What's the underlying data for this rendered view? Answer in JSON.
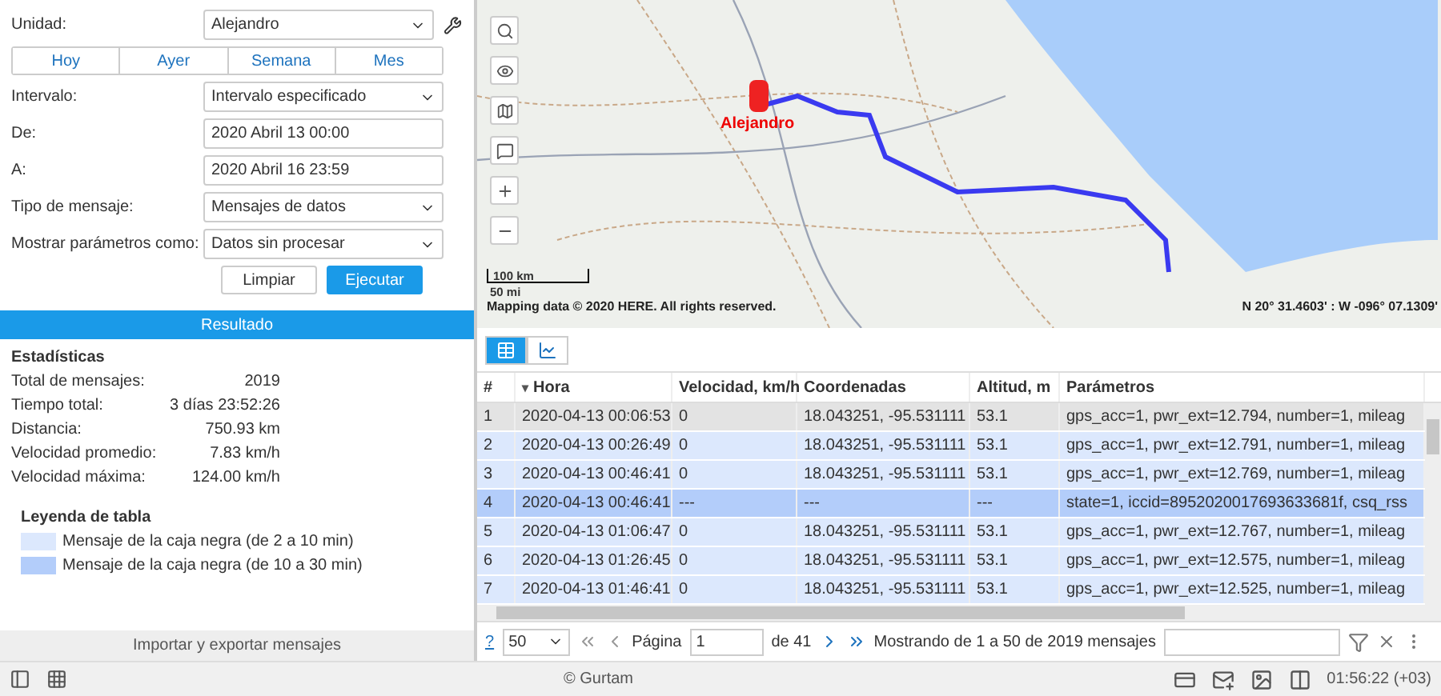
{
  "form": {
    "unit": {
      "label": "Unidad:",
      "value": "Alejandro"
    },
    "quick": [
      {
        "label": "Hoy",
        "selected": false
      },
      {
        "label": "Ayer",
        "selected": false
      },
      {
        "label": "Semana",
        "selected": false
      },
      {
        "label": "Mes",
        "selected": false
      }
    ],
    "fields": [
      {
        "kind": "select",
        "label": "Intervalo:",
        "value": "Intervalo especificado"
      },
      {
        "kind": "input",
        "label": "De:",
        "value": "2020 Abril 13 00:00"
      },
      {
        "kind": "input",
        "label": "A:",
        "value": "2020 Abril 16 23:59"
      },
      {
        "kind": "select",
        "label": "Tipo de mensaje:",
        "value": "Mensajes de datos"
      },
      {
        "kind": "select",
        "label": "Mostrar parámetros como:",
        "value": "Datos sin procesar"
      }
    ],
    "buttons": [
      "Limpiar",
      "Ejecutar"
    ]
  },
  "result": {
    "title": "Resultado",
    "stats_title": "Estadísticas",
    "stats": [
      {
        "label": "Total de mensajes:",
        "value": "2019"
      },
      {
        "label": "Tiempo total:",
        "value": "3 días 23:52:26"
      },
      {
        "label": "Distancia:",
        "value": "750.93 km"
      },
      {
        "label": "Velocidad promedio:",
        "value": "7.83 km/h"
      },
      {
        "label": "Velocidad máxima:",
        "value": "124.00 km/h"
      }
    ],
    "legend_title": "Leyenda de tabla",
    "legend": [
      {
        "label": "Mensaje de la caja negra (de 2 a 10 min)",
        "color": "#dce8fd"
      },
      {
        "label": "Mensaje de la caja negra (de 10 a 30 min)",
        "color": "#b3cdfa"
      }
    ],
    "import_export": "Importar y exportar mensajes"
  },
  "map": {
    "unit_label": "Alejandro",
    "scale_km": "100 km",
    "scale_mi": "50 mi",
    "attribution": "Mapping data © 2020 HERE. All rights reserved.",
    "coordinates": "N 20° 31.4603' : W -096° 07.1309'"
  },
  "view_tabs": [
    {
      "kind": "table",
      "selected": true
    },
    {
      "kind": "chart",
      "selected": false
    }
  ],
  "table": {
    "columns": [
      {
        "label": "#"
      },
      {
        "label": "Hora",
        "sort": "▾"
      },
      {
        "label": "Velocidad, km/h"
      },
      {
        "label": "Coordenadas"
      },
      {
        "label": "Altitud, m"
      },
      {
        "label": "Parámetros"
      }
    ],
    "rows": [
      {
        "cells": [
          "1",
          "2020-04-13 00:06:53",
          "0",
          "18.043251, -95.531111",
          "53.1",
          "gps_acc=1, pwr_ext=12.794, number=1, mileag"
        ],
        "selected": true
      },
      {
        "cells": [
          "2",
          "2020-04-13 00:26:49",
          "0",
          "18.043251, -95.531111",
          "53.1",
          "gps_acc=1, pwr_ext=12.791, number=1, mileag"
        ],
        "selected": false,
        "color": "#dce8fd"
      },
      {
        "cells": [
          "3",
          "2020-04-13 00:46:41",
          "0",
          "18.043251, -95.531111",
          "53.1",
          "gps_acc=1, pwr_ext=12.769, number=1, mileag"
        ],
        "selected": false,
        "color": "#dce8fd"
      },
      {
        "cells": [
          "4",
          "2020-04-13 00:46:41",
          "---",
          "---",
          "---",
          "state=1, iccid=8952020017693633681f, csq_rss"
        ],
        "selected": false,
        "color": "#b3cdfa"
      },
      {
        "cells": [
          "5",
          "2020-04-13 01:06:47",
          "0",
          "18.043251, -95.531111",
          "53.1",
          "gps_acc=1, pwr_ext=12.767, number=1, mileag"
        ],
        "selected": false,
        "color": "#dce8fd"
      },
      {
        "cells": [
          "6",
          "2020-04-13 01:26:45",
          "0",
          "18.043251, -95.531111",
          "53.1",
          "gps_acc=1, pwr_ext=12.575, number=1, mileag"
        ],
        "selected": false,
        "color": "#dce8fd"
      },
      {
        "cells": [
          "7",
          "2020-04-13 01:46:41",
          "0",
          "18.043251, -95.531111",
          "53.1",
          "gps_acc=1, pwr_ext=12.525, number=1, mileag"
        ],
        "selected": false,
        "color": "#dce8fd"
      }
    ]
  },
  "pager": {
    "help": "?",
    "per_page": "50",
    "page_label": "Página",
    "page": "1",
    "of": "de 41",
    "showing": "Mostrando de 1 a 50 de 2019 mensajes"
  },
  "status_bar": {
    "copyright": "© Gurtam",
    "time": "01:56:22 (+03)"
  }
}
